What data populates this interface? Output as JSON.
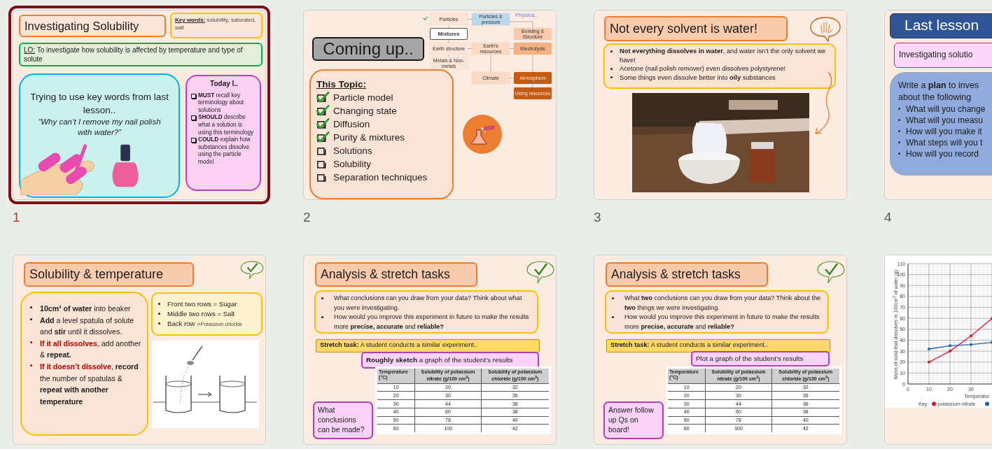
{
  "slides": [
    {
      "number": "1",
      "selected": true,
      "kind": "intro",
      "title": "Investigating Solubility",
      "keywords_label": "Key words:",
      "keywords": "solubility, saturated, salt",
      "objective_label": "LO:",
      "objective": "To investigate how solubility is affected by temperature and type of solute",
      "prompt": "Trying to use key words from last lesson..",
      "question": "“Why can’t I remove my nail polish with water?”",
      "goals_title": "Today I..",
      "goals": [
        "**MUST** recall key terminology about solutions",
        "**SHOULD** describe what a solution is using this terminology",
        "**COULD** explain how substances dissolve using the particle model"
      ]
    },
    {
      "number": "2",
      "selected": false,
      "kind": "overview",
      "title": "Coming up..",
      "topic_title": "This Topic:",
      "topics": [
        {
          "label": "Particle model",
          "checked": true
        },
        {
          "label": "Changing state",
          "checked": true
        },
        {
          "label": "Diffusion",
          "checked": true
        },
        {
          "label": "Purity & mixtures",
          "checked": true
        },
        {
          "label": "Solutions",
          "checked": false
        },
        {
          "label": "Solubility",
          "checked": false
        },
        {
          "label": "Separation techniques",
          "checked": false
        }
      ],
      "map_note": "Physics..",
      "map_nodes": [
        {
          "label": "Particles",
          "color": "#fce4d6",
          "done": true
        },
        {
          "label": "Particles & pressure",
          "color": "#bdd7ee",
          "done": false
        },
        {
          "label": "Mixtures",
          "color": "#ffffff",
          "done": false
        },
        {
          "label": "Bonding & Structure",
          "color": "#f8cbad",
          "done": false
        },
        {
          "label": "Earth structure",
          "color": "#fce4d6",
          "done": false
        },
        {
          "label": "Earth’s resources",
          "color": "#fbdac4",
          "done": false
        },
        {
          "label": "Electrolysis",
          "color": "#f4b183",
          "done": false
        },
        {
          "label": "Metals & Non-metals",
          "color": "#fce4d6",
          "done": false
        },
        {
          "label": "Atmosphere",
          "color": "#c55a11",
          "done": false
        },
        {
          "label": "Climate",
          "color": "#fbdac4",
          "done": false
        },
        {
          "label": "Using resources",
          "color": "#c55a11",
          "done": false
        }
      ]
    },
    {
      "number": "3",
      "selected": false,
      "title": "Not every solvent is water!",
      "points": [
        "**Not everything dissolves in water**, and water isn’t the only solvent we have!",
        "Acetone (nail polish remover) even dissolves polystyrene!",
        "Some things even dissolve better into **oily** substances"
      ],
      "media": {
        "kind": "picture"
      }
    },
    {
      "number": "4",
      "selected": false,
      "kind": "recap",
      "title": "Last lesson",
      "subtitle": "Investigating solutio",
      "task_lines": [
        "Write a **plan** to inves",
        "about the following"
      ],
      "questions": [
        "What will you change",
        "What will you measu",
        "How will you make it",
        "What steps will you t",
        "How will you record"
      ]
    },
    {
      "selected": false,
      "kind": "method",
      "title": "Solubility & temperature",
      "steps": [
        {
          "kind": "action",
          "lead": "10cm³ of water",
          "rest": " into beaker"
        },
        {
          "kind": "action",
          "lead": "Add",
          "rest": " a level spatula of solute and **stir** until it dissolves."
        },
        {
          "kind": "condition",
          "lead": "If it all dissolves",
          "rest": ", add another & **repeat.**"
        },
        {
          "kind": "condition",
          "lead": "If it doesn’t dissolve",
          "rest": ", **record** the number of spatulas & **repeat with another temperature**"
        }
      ],
      "groups": [
        {
          "text": "Front two rows = Sugar"
        },
        {
          "text": "Middle two rows = Salt"
        },
        {
          "text": "Back row =",
          "note": "Potassium chloride"
        }
      ]
    },
    {
      "selected": false,
      "kind": "analysis",
      "title": "Analysis & stretch tasks",
      "points": [
        "What conclusions can you draw from your data? Think about what you were investigating.",
        "How would you improve this experiment in future to make the results more **precise, accurate** and **reliable?**"
      ],
      "stretch": "**Stretch task:** A student conducts a similar experiment..",
      "instruction": "**Roughly sketch** a graph of the student’s results",
      "table": {
        "columns": [
          "Temperature (°C)",
          "Solubility of potassium nitrate (g/100 cm$^{3}$)",
          "Solubility of potassium chloride (g/100 cm$^{3}$)"
        ],
        "rows": [
          [
            "10",
            "20",
            "32"
          ],
          [
            "20",
            "30",
            "35"
          ],
          [
            "30",
            "44",
            "36"
          ],
          [
            "40",
            "60",
            "38"
          ],
          [
            "50",
            "78",
            "40"
          ],
          [
            "60",
            "100",
            "42"
          ]
        ]
      },
      "note": "What conclusions can be made?"
    },
    {
      "selected": false,
      "kind": "analysis",
      "title": "Analysis & stretch tasks",
      "points": [
        "What **two** conclusions can you draw from your data? Think about the **two** things we were investigating.",
        "How would you improve this experiment in future to make the results more **precise, accurate** and **reliable?**"
      ],
      "stretch": "**Stretch task:** A student conducts a similar experiment..",
      "instruction": "Plot a graph of the student’s results",
      "table": {
        "columns": [
          "Temperature (°C)",
          "Solubility of potassium nitrate (g/100 cm$^{3}$)",
          "Solubility of potassium chloride (g/100 cm$^{3}$)"
        ],
        "rows": [
          [
            "10",
            "20",
            "32"
          ],
          [
            "20",
            "30",
            "35"
          ],
          [
            "30",
            "44",
            "36"
          ],
          [
            "40",
            "60",
            "38"
          ],
          [
            "50",
            "78",
            "40"
          ],
          [
            "60",
            "100",
            "42"
          ]
        ]
      },
      "note": "Answer follow up Qs on board!"
    },
    {
      "selected": false,
      "kind": "graph",
      "legend_title": "Key:",
      "chart_data": {
        "type": "line",
        "grid": true,
        "xlabel": "Temperatur",
        "ylabel": "Mass of solid that dissolves in 100cm$^{3}$ of water (g)",
        "x": [
          10,
          20,
          30,
          40
        ],
        "series": [
          {
            "name": "potassium nitrate",
            "color": "#e8112d",
            "values": [
              20,
              30,
              44,
              60
            ]
          },
          {
            "color": "#1f5fa8",
            "values": [
              32,
              35,
              36,
              38
            ]
          }
        ],
        "xlim": [
          0,
          42
        ],
        "ylim": [
          0,
          110
        ],
        "xticks": [
          0,
          10,
          20,
          30
        ],
        "yticks": [
          0,
          10,
          20,
          30,
          40,
          50,
          60,
          70,
          80,
          90,
          100,
          110
        ]
      }
    }
  ]
}
